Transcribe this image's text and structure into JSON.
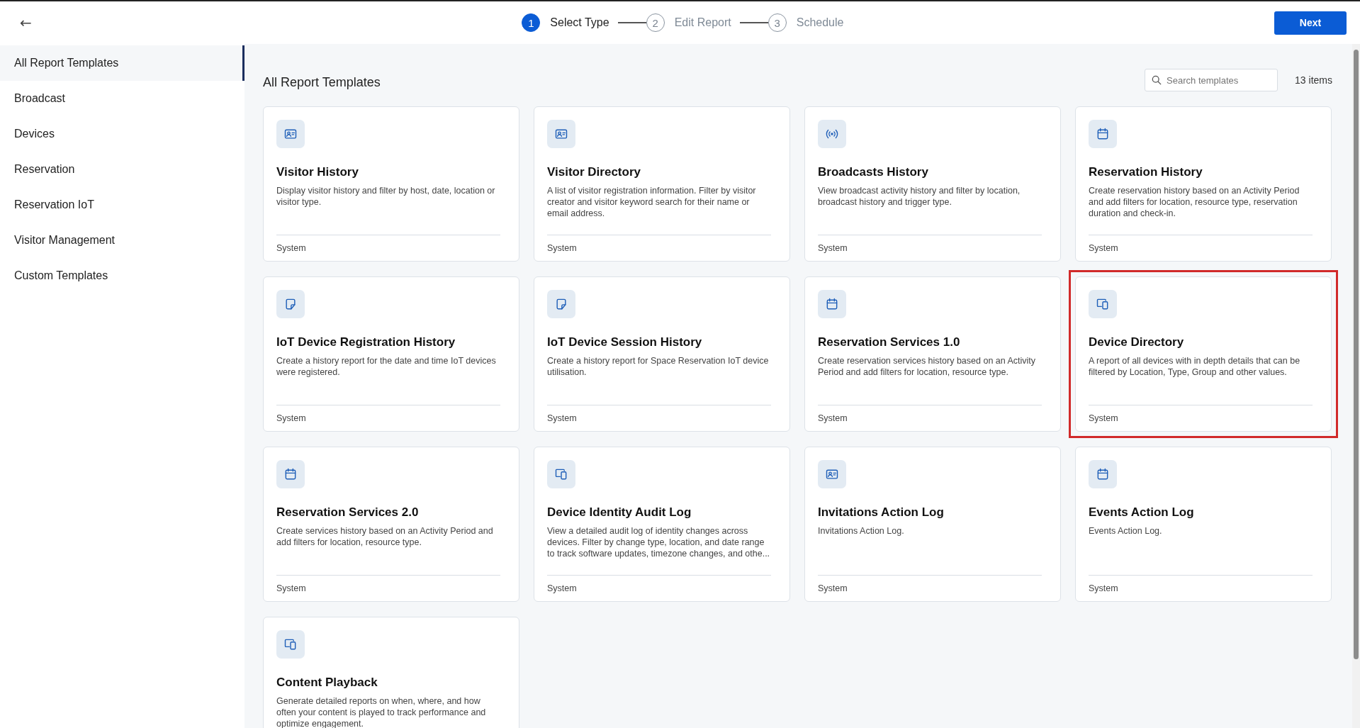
{
  "header": {
    "back_label": "←",
    "steps": [
      {
        "number": "1",
        "label": "Select Type",
        "selected": true
      },
      {
        "number": "2",
        "label": "Edit Report",
        "selected": false
      },
      {
        "number": "3",
        "label": "Schedule",
        "selected": false
      }
    ],
    "next_button": "Next"
  },
  "sidebar": {
    "items": [
      {
        "label": "All Report Templates",
        "selected": true
      },
      {
        "label": "Broadcast",
        "selected": false
      },
      {
        "label": "Devices",
        "selected": false
      },
      {
        "label": "Reservation",
        "selected": false
      },
      {
        "label": "Reservation IoT",
        "selected": false
      },
      {
        "label": "Visitor Management",
        "selected": false
      },
      {
        "label": "Custom Templates",
        "selected": false
      }
    ]
  },
  "main": {
    "title": "All Report Templates",
    "search": {
      "placeholder": "Search templates"
    },
    "count": "13 items",
    "cards": [
      {
        "kind": "id-card",
        "title": "Visitor History",
        "description": "Display visitor history and filter by host, date, location or visitor type.",
        "footer": "System",
        "highlighted": false
      },
      {
        "kind": "id-card",
        "title": "Visitor Directory",
        "description": "A list of visitor registration information. Filter by visitor creator and visitor keyword search for their name or email address.",
        "footer": "System",
        "highlighted": false
      },
      {
        "kind": "broadcast",
        "title": "Broadcasts History",
        "description": "View broadcast activity history and filter by location, broadcast history and trigger type.",
        "footer": "System",
        "highlighted": false
      },
      {
        "kind": "calendar",
        "title": "Reservation History",
        "description": "Create reservation history based on an Activity Period and add filters for location, resource type, reservation duration and check-in.",
        "footer": "System",
        "highlighted": false
      },
      {
        "kind": "note",
        "title": "IoT Device Registration History",
        "description": "Create a history report for the date and time IoT devices were registered.",
        "footer": "System",
        "highlighted": false
      },
      {
        "kind": "note",
        "title": "IoT Device Session History",
        "description": "Create a history report for Space Reservation IoT device utilisation.",
        "footer": "System",
        "highlighted": false
      },
      {
        "kind": "calendar",
        "title": "Reservation Services 1.0",
        "description": "Create reservation services history based on an Activity Period and add filters for location, resource type.",
        "footer": "System",
        "highlighted": false
      },
      {
        "kind": "devices",
        "title": "Device Directory",
        "description": "A report of all devices with in depth details that can be filtered by Location, Type, Group and other values.",
        "footer": "System",
        "highlighted": true
      },
      {
        "kind": "calendar",
        "title": "Reservation Services 2.0",
        "description": "Create services history based on an Activity Period and add filters for location, resource type.",
        "footer": "System",
        "highlighted": false
      },
      {
        "kind": "devices",
        "title": "Device Identity Audit Log",
        "description": "View a detailed audit log of identity changes across devices. Filter by change type, location, and date range to track software updates, timezone changes, and othe...",
        "footer": "System",
        "highlighted": false
      },
      {
        "kind": "id-card",
        "title": "Invitations Action Log",
        "description": "Invitations Action Log.",
        "footer": "System",
        "highlighted": false
      },
      {
        "kind": "calendar",
        "title": "Events Action Log",
        "description": "Events Action Log.",
        "footer": "System",
        "highlighted": false
      },
      {
        "kind": "devices",
        "title": "Content Playback",
        "description": "Generate detailed reports on when, where, and how often your content is played to track performance and optimize engagement.",
        "highlighted": false
      }
    ]
  }
}
